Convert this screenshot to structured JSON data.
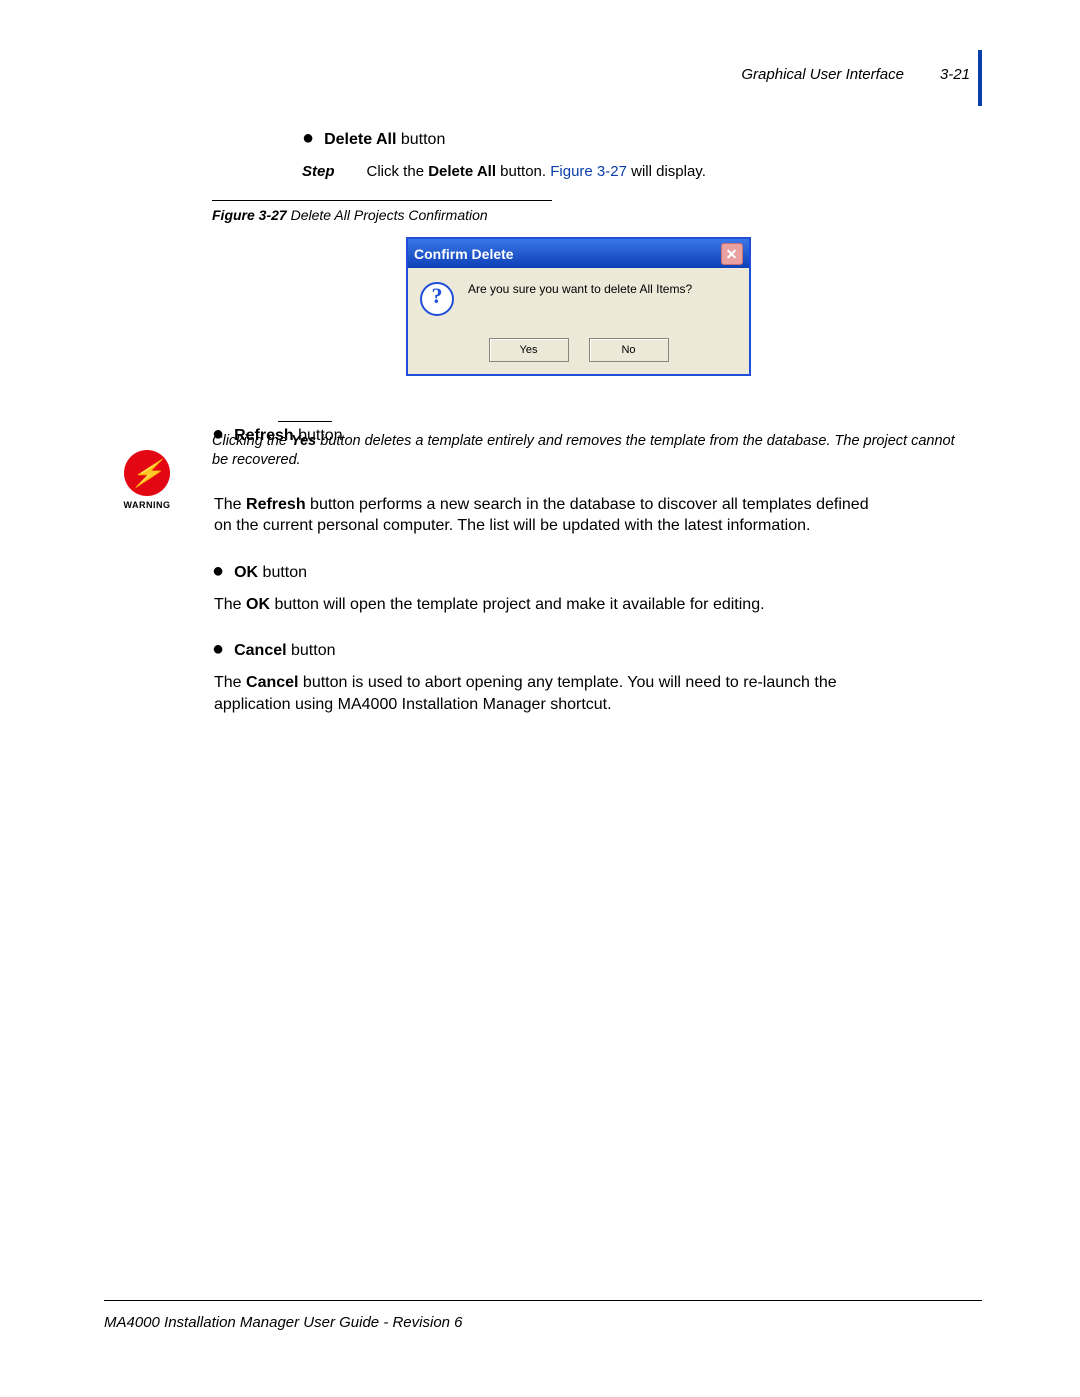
{
  "header": {
    "section": "Graphical User Interface",
    "pagenum": "3-21"
  },
  "deleteAll": {
    "bold": "Delete All",
    "tail": " button",
    "step_label": "Step",
    "step_prefix": "Click the ",
    "step_bold": "Delete All",
    "step_mid": " button. ",
    "figref": "Figure 3-27",
    "step_suffix": " will display."
  },
  "figure": {
    "label": "Figure 3-27",
    "title": "  Delete All Projects Confirmation"
  },
  "dialog": {
    "title": "Confirm Delete",
    "message": "Are you sure you want to delete All Items?",
    "yes": "Yes",
    "no": "No"
  },
  "refresh": {
    "bold": "Refresh",
    "tail": " button",
    "warn_pre": "Clicking the ",
    "warn_bold": "Yes",
    "warn_post": " button deletes a template entirely and removes the template from the database. The project cannot be recovered.",
    "para_pre": "The ",
    "para_bold": "Refresh",
    "para_post": " button performs a new search in the database to discover all templates defined on the current personal computer. The list will be updated with the latest information."
  },
  "ok": {
    "bold": "OK",
    "tail": " button",
    "para_pre": "The ",
    "para_bold": "OK",
    "para_post": " button will open the template project and make it available for editing."
  },
  "cancel": {
    "bold": "Cancel",
    "tail": " button",
    "para_pre": "The ",
    "para_bold": "Cancel",
    "para_post": " button is used to abort opening any template. You will need to re-launch the application using MA4000 Installation Manager shortcut."
  },
  "warning_label": "WARNING",
  "footer": "MA4000 Installation Manager User Guide - Revision 6"
}
